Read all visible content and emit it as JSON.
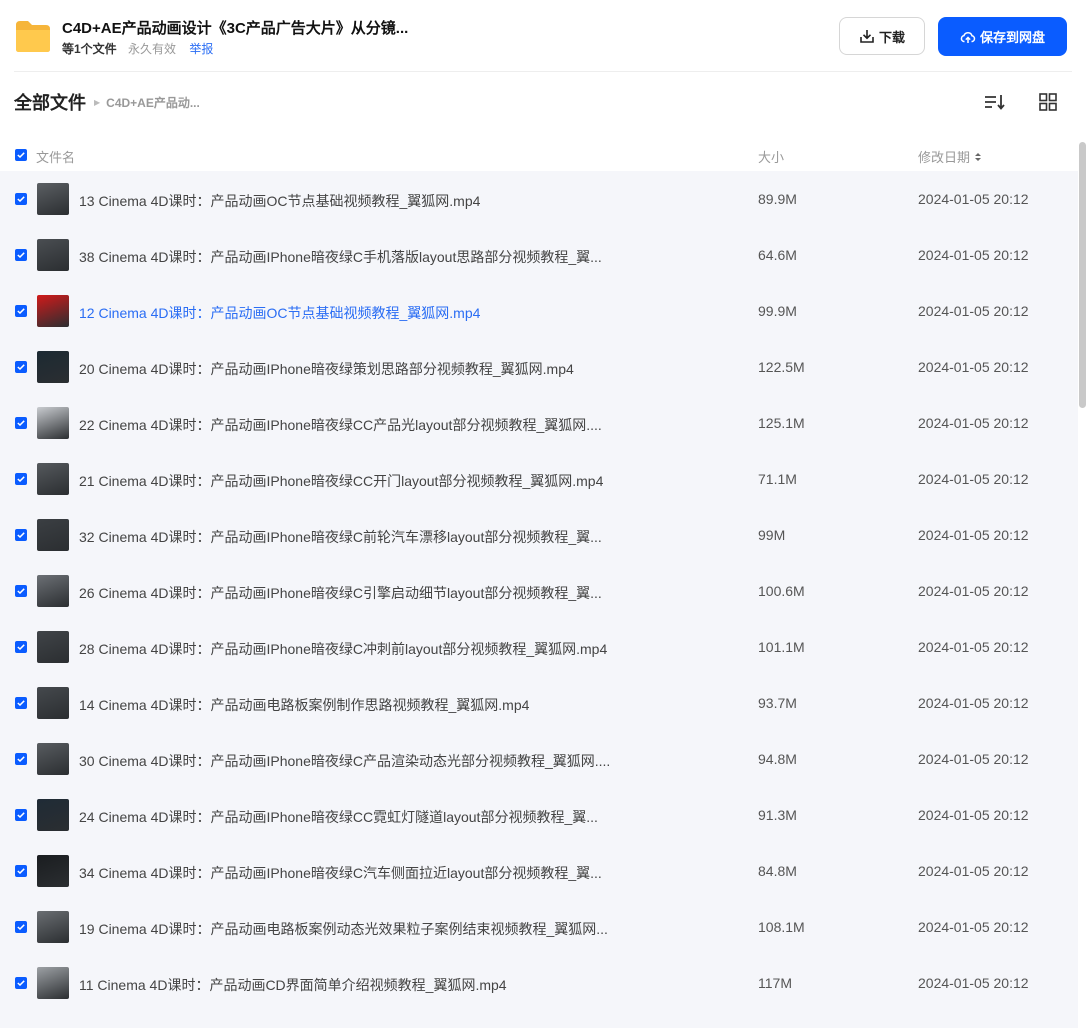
{
  "header": {
    "title": "C4D+AE产品动画设计《3C产品广告大片》从分镜...",
    "file_count": "等1个文件",
    "validity": "永久有效",
    "report": "举报",
    "download_label": "下载",
    "save_label": "保存到网盘"
  },
  "breadcrumb": {
    "root": "全部文件",
    "current": "C4D+AE产品动..."
  },
  "columns": {
    "name": "文件名",
    "size": "大小",
    "date": "修改日期"
  },
  "colors": {
    "accent": "#0a5cff",
    "link": "#2a6df4",
    "list_bg": "#f5f6fa"
  },
  "files": [
    {
      "name": "13 Cinema 4D课时：产品动画OC节点基础视频教程_翼狐网.mp4",
      "size": "89.9M",
      "date": "2024-01-05 20:12",
      "thumb": "#5b5f63"
    },
    {
      "name": "38 Cinema 4D课时：产品动画IPhone暗夜绿C手机落版layout思路部分视频教程_翼...",
      "size": "64.6M",
      "date": "2024-01-05 20:12",
      "thumb": "#4a4e52"
    },
    {
      "name": "12 Cinema 4D课时：产品动画OC节点基础视频教程_翼狐网.mp4",
      "size": "99.9M",
      "date": "2024-01-05 20:12",
      "thumb": "#d11a1a",
      "active": true
    },
    {
      "name": "20 Cinema 4D课时：产品动画IPhone暗夜绿策划思路部分视频教程_翼狐网.mp4",
      "size": "122.5M",
      "date": "2024-01-05 20:12",
      "thumb": "#1c2a33"
    },
    {
      "name": "22 Cinema 4D课时：产品动画IPhone暗夜绿CC产品光layout部分视频教程_翼狐网....",
      "size": "125.1M",
      "date": "2024-01-05 20:12",
      "thumb": "#c9ccd0"
    },
    {
      "name": "21 Cinema 4D课时：产品动画IPhone暗夜绿CC开门layout部分视频教程_翼狐网.mp4",
      "size": "71.1M",
      "date": "2024-01-05 20:12",
      "thumb": "#55595d"
    },
    {
      "name": "32 Cinema 4D课时：产品动画IPhone暗夜绿C前轮汽车漂移layout部分视频教程_翼...",
      "size": "99M",
      "date": "2024-01-05 20:12",
      "thumb": "#3b3f43"
    },
    {
      "name": "26 Cinema 4D课时：产品动画IPhone暗夜绿C引擎启动细节layout部分视频教程_翼...",
      "size": "100.6M",
      "date": "2024-01-05 20:12",
      "thumb": "#6c7075"
    },
    {
      "name": "28 Cinema 4D课时：产品动画IPhone暗夜绿C冲刺前layout部分视频教程_翼狐网.mp4",
      "size": "101.1M",
      "date": "2024-01-05 20:12",
      "thumb": "#404448"
    },
    {
      "name": "14 Cinema 4D课时：产品动画电路板案例制作思路视频教程_翼狐网.mp4",
      "size": "93.7M",
      "date": "2024-01-05 20:12",
      "thumb": "#45494d"
    },
    {
      "name": "30 Cinema 4D课时：产品动画IPhone暗夜绿C产品渲染动态光部分视频教程_翼狐网....",
      "size": "94.8M",
      "date": "2024-01-05 20:12",
      "thumb": "#585c60"
    },
    {
      "name": "24 Cinema 4D课时：产品动画IPhone暗夜绿CC霓虹灯隧道layout部分视频教程_翼...",
      "size": "91.3M",
      "date": "2024-01-05 20:12",
      "thumb": "#1f2b36"
    },
    {
      "name": "34 Cinema 4D课时：产品动画IPhone暗夜绿C汽车侧面拉近layout部分视频教程_翼...",
      "size": "84.8M",
      "date": "2024-01-05 20:12",
      "thumb": "#1a1d20"
    },
    {
      "name": "19 Cinema 4D课时：产品动画电路板案例动态光效果粒子案例结束视频教程_翼狐网...",
      "size": "108.1M",
      "date": "2024-01-05 20:12",
      "thumb": "#6a6e72"
    },
    {
      "name": "11 Cinema 4D课时：产品动画CD界面简单介绍视频教程_翼狐网.mp4",
      "size": "117M",
      "date": "2024-01-05 20:12",
      "thumb": "#9da1a5"
    }
  ]
}
